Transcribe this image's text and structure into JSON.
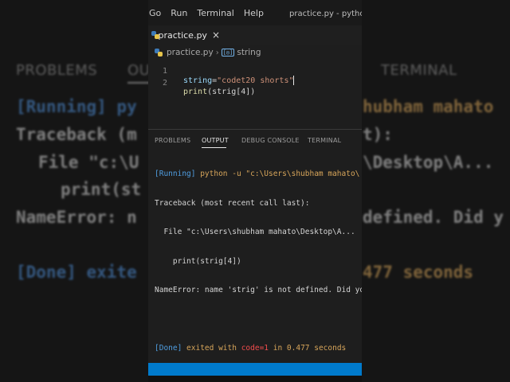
{
  "background": {
    "tabs": [
      "PROBLEMS",
      "OU",
      "TERMINAL"
    ],
    "lines": [
      "[Running] py",
      "Traceback (m",
      "File \"c:\\U",
      "print(st",
      "NameError: n",
      "[Done] exite"
    ],
    "lines_right": [
      "hubham mahato",
      "t):",
      "\\Desktop\\A...",
      "",
      "defined. Did y",
      "477 seconds"
    ]
  },
  "menubar": {
    "items": [
      "Go",
      "Run",
      "Terminal",
      "Help"
    ],
    "window_title": "practice.py - python - "
  },
  "editor": {
    "tab_label": "practice.py",
    "tab_close": "×",
    "breadcrumb_file": "practice.py",
    "breadcrumb_sep": "›",
    "breadcrumb_symbol_icon": "[◎]",
    "breadcrumb_symbol": "string",
    "lines": [
      {
        "number": "1",
        "var": "string",
        "op": "=",
        "str": "\"codet20 shorts\""
      },
      {
        "number": "2",
        "fn": "print",
        "rest": "(strig[4])"
      }
    ]
  },
  "panel": {
    "tabs": [
      "PROBLEMS",
      "OUTPUT",
      "DEBUG CONSOLE",
      "TERMINAL"
    ],
    "active_tab": "OUTPUT",
    "output": {
      "running_tag": "[Running]",
      "running_cmd": " python -u \"c:\\Users\\shubham mahato\\",
      "traceback": "Traceback (most recent call last):",
      "file_line": "  File \"c:\\Users\\shubham mahato\\Desktop\\A...",
      "print_line": "    print(strig[4])",
      "error_line": "NameError: name 'strig' is not defined. Did you",
      "done_tag": "[Done]",
      "done_pre": " exited with ",
      "done_code": "code=1",
      "done_mid": " in ",
      "done_time": "0.477",
      "done_post": " seconds"
    }
  },
  "colors": {
    "statusbar": "#007acc",
    "editor_bg": "#1e1e1e"
  }
}
